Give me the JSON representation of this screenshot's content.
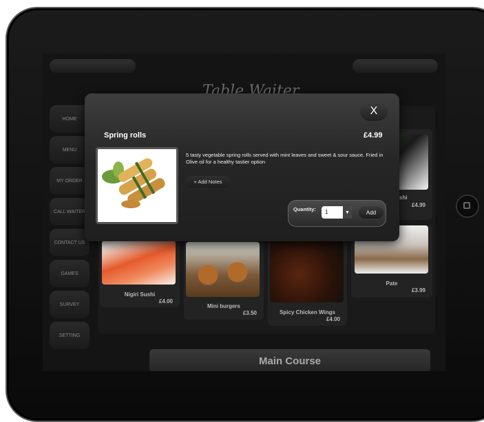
{
  "nav": [
    "HOME",
    "MENU",
    "MY ORDER",
    "CALL WAITER",
    "CONTACT US",
    "GAMES",
    "SURVEY",
    "SETTING"
  ],
  "logo_text": "Table Waiter",
  "menu_items": [
    {
      "name": "Nigiri Sushi",
      "price": "£4.00"
    },
    {
      "name": "Mini burgers",
      "price": "£3.50"
    },
    {
      "name": "Spicy Chicken Wings",
      "price": "£4.00"
    },
    {
      "name": "Pate",
      "price": "£3.99"
    },
    {
      "name": "shi",
      "price": "£4.99"
    }
  ],
  "section_title": "Main Course",
  "modal": {
    "close_label": "X",
    "title": "Spring rolls",
    "price": "£4.99",
    "description": "5 tasty vegetable spring rolls served with mint leaves and sweet & sour sauce. Fried in Olive oil for a healthy tastier option",
    "notes_label": "+ Add Notes",
    "quantity_label": "Quantity:",
    "quantity_value": "1",
    "add_label": "Add"
  }
}
